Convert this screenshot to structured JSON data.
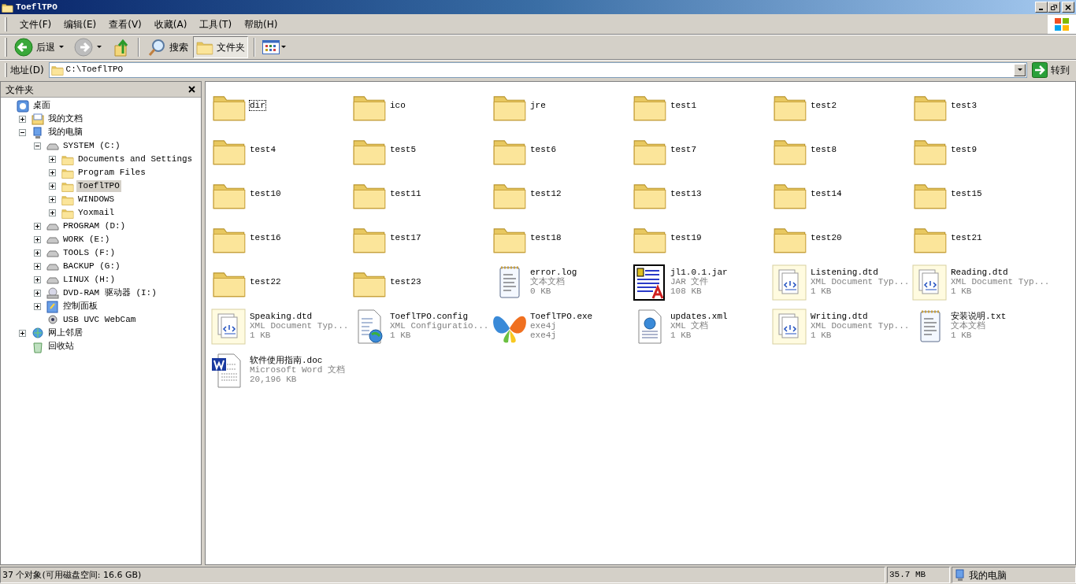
{
  "window": {
    "title": "ToeflTPO"
  },
  "menu": [
    "文件(F)",
    "编辑(E)",
    "查看(V)",
    "收藏(A)",
    "工具(T)",
    "帮助(H)"
  ],
  "toolbar": {
    "back": {
      "label": "后退"
    },
    "forward": {
      "disabled": true
    },
    "search": {
      "label": "搜索",
      "pressed": false
    },
    "folders": {
      "label": "文件夹",
      "pressed": true
    }
  },
  "address": {
    "label": "地址(D)",
    "value": "C:\\ToeflTPO",
    "go": "转到"
  },
  "folders_pane": {
    "title": "文件夹",
    "tree": [
      {
        "label": "桌面",
        "kind": "desktop",
        "selected": false,
        "children": [
          {
            "label": "我的文档",
            "kind": "docs",
            "selected": false,
            "expanded": false
          },
          {
            "label": "我的电脑",
            "kind": "computer",
            "selected": false,
            "expanded": true,
            "children": [
              {
                "label": "SYSTEM (C:)",
                "kind": "drive",
                "selected": false,
                "expanded": true,
                "children": [
                  {
                    "label": "Documents and Settings",
                    "kind": "folder",
                    "selected": false,
                    "expanded": false
                  },
                  {
                    "label": "Program Files",
                    "kind": "folder",
                    "selected": false,
                    "expanded": false
                  },
                  {
                    "label": "ToeflTPO",
                    "kind": "folder",
                    "selected": true,
                    "expanded": false
                  },
                  {
                    "label": "WINDOWS",
                    "kind": "folder",
                    "selected": false,
                    "expanded": false
                  },
                  {
                    "label": "Yoxmail",
                    "kind": "folder",
                    "selected": false,
                    "expanded": false
                  }
                ]
              },
              {
                "label": "PROGRAM (D:)",
                "kind": "drive",
                "selected": false,
                "expanded": false
              },
              {
                "label": "WORK (E:)",
                "kind": "drive",
                "selected": false,
                "expanded": false
              },
              {
                "label": "TOOLS (F:)",
                "kind": "drive",
                "selected": false,
                "expanded": false
              },
              {
                "label": "BACKUP (G:)",
                "kind": "drive",
                "selected": false,
                "expanded": false
              },
              {
                "label": "LINUX (H:)",
                "kind": "drive",
                "selected": false,
                "expanded": false
              },
              {
                "label": "DVD-RAM 驱动器 (I:)",
                "kind": "dvd",
                "selected": false,
                "expanded": false
              },
              {
                "label": "控制面板",
                "kind": "control",
                "selected": false,
                "expanded": false
              },
              {
                "label": "USB UVC WebCam",
                "kind": "webcam",
                "selected": false
              }
            ]
          },
          {
            "label": "网上邻居",
            "kind": "network",
            "selected": false,
            "expanded": false
          },
          {
            "label": "回收站",
            "kind": "recycle",
            "selected": false
          }
        ]
      }
    ]
  },
  "files": [
    {
      "name": "dir",
      "kind": "folder",
      "selected": true
    },
    {
      "name": "ico",
      "kind": "folder",
      "selected": false
    },
    {
      "name": "jre",
      "kind": "folder",
      "selected": false
    },
    {
      "name": "test1",
      "kind": "folder",
      "selected": false
    },
    {
      "name": "test2",
      "kind": "folder",
      "selected": false
    },
    {
      "name": "test3",
      "kind": "folder",
      "selected": false
    },
    {
      "name": "test4",
      "kind": "folder",
      "selected": false
    },
    {
      "name": "test5",
      "kind": "folder",
      "selected": false
    },
    {
      "name": "test6",
      "kind": "folder",
      "selected": false
    },
    {
      "name": "test7",
      "kind": "folder",
      "selected": false
    },
    {
      "name": "test8",
      "kind": "folder",
      "selected": false
    },
    {
      "name": "test9",
      "kind": "folder",
      "selected": false
    },
    {
      "name": "test10",
      "kind": "folder",
      "selected": false
    },
    {
      "name": "test11",
      "kind": "folder",
      "selected": false
    },
    {
      "name": "test12",
      "kind": "folder",
      "selected": false
    },
    {
      "name": "test13",
      "kind": "folder",
      "selected": false
    },
    {
      "name": "test14",
      "kind": "folder",
      "selected": false
    },
    {
      "name": "test15",
      "kind": "folder",
      "selected": false
    },
    {
      "name": "test16",
      "kind": "folder",
      "selected": false
    },
    {
      "name": "test17",
      "kind": "folder",
      "selected": false
    },
    {
      "name": "test18",
      "kind": "folder",
      "selected": false
    },
    {
      "name": "test19",
      "kind": "folder",
      "selected": false
    },
    {
      "name": "test20",
      "kind": "folder",
      "selected": false
    },
    {
      "name": "test21",
      "kind": "folder",
      "selected": false
    },
    {
      "name": "test22",
      "kind": "folder",
      "selected": false
    },
    {
      "name": "test23",
      "kind": "folder",
      "selected": false
    },
    {
      "name": "error.log",
      "kind": "text",
      "type": "文本文档",
      "size": "0 KB",
      "selected": false
    },
    {
      "name": "jl1.0.1.jar",
      "kind": "jar",
      "type": "JAR 文件",
      "size": "108 KB",
      "selected": false
    },
    {
      "name": "Listening.dtd",
      "kind": "dtd",
      "type": "XML Document Typ...",
      "size": "1 KB",
      "selected": false
    },
    {
      "name": "Reading.dtd",
      "kind": "dtd",
      "type": "XML Document Typ...",
      "size": "1 KB",
      "selected": false
    },
    {
      "name": "Speaking.dtd",
      "kind": "dtd",
      "type": "XML Document Typ...",
      "size": "1 KB",
      "selected": false
    },
    {
      "name": "ToeflTPO.config",
      "kind": "config",
      "type": "XML Configuratio...",
      "size": "1 KB",
      "selected": false
    },
    {
      "name": "ToeflTPO.exe",
      "kind": "exe",
      "type": "exe4j",
      "size": "exe4j",
      "selected": false
    },
    {
      "name": "updates.xml",
      "kind": "xml",
      "type": "XML 文档",
      "size": "1 KB",
      "selected": false
    },
    {
      "name": "Writing.dtd",
      "kind": "dtd",
      "type": "XML Document Typ...",
      "size": "1 KB",
      "selected": false
    },
    {
      "name": "安装说明.txt",
      "kind": "text",
      "type": "文本文档",
      "size": "1 KB",
      "selected": false
    },
    {
      "name": "软件使用指南.doc",
      "kind": "doc",
      "type": "Microsoft Word 文档",
      "size": "20,196 KB",
      "selected": false
    }
  ],
  "status_bar": {
    "objects": "37 个对象(可用磁盘空间: 16.6 GB)",
    "size": "35.7 MB",
    "zone": "我的电脑"
  }
}
